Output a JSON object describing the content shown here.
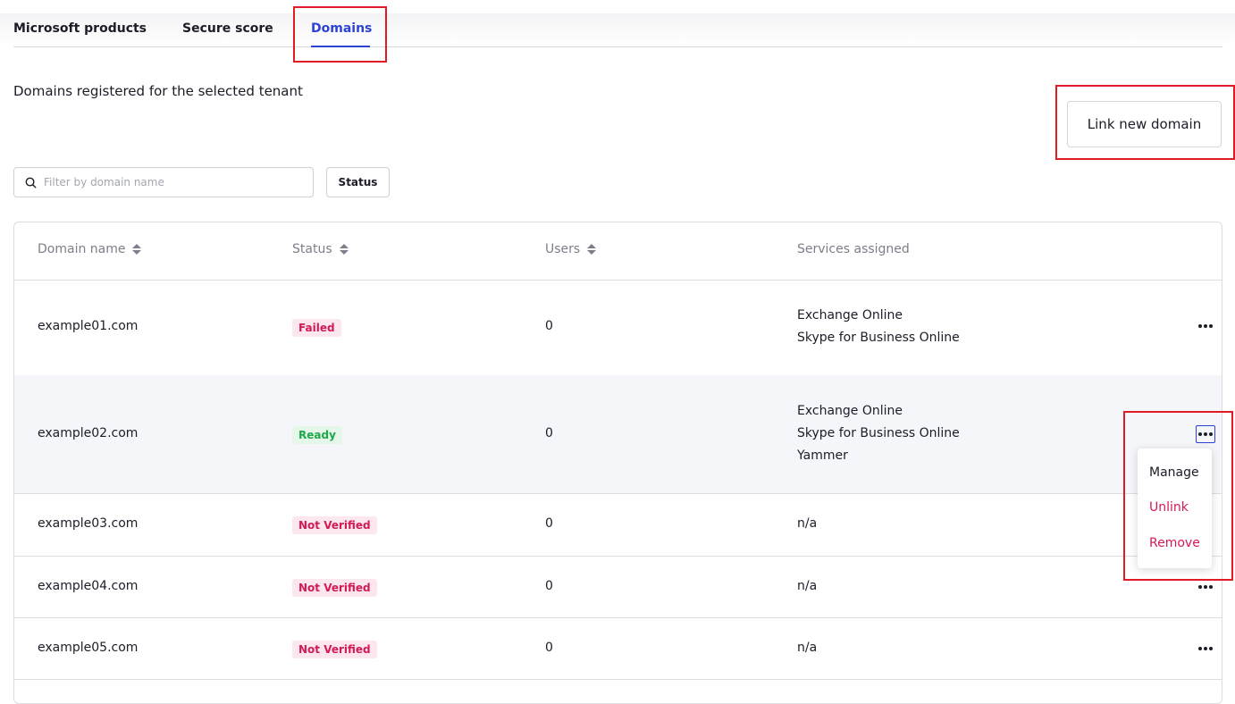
{
  "tabs": [
    {
      "label": "Microsoft products",
      "active": false
    },
    {
      "label": "Secure score",
      "active": false
    },
    {
      "label": "Domains",
      "active": true
    }
  ],
  "page": {
    "subtitle": "Domains registered for the selected tenant",
    "link_button": "Link new domain"
  },
  "filters": {
    "search_placeholder": "Filter by domain name",
    "status_button": "Status"
  },
  "table": {
    "columns": [
      "Domain name",
      "Status",
      "Users",
      "Services assigned"
    ],
    "rows": [
      {
        "domain": "example01.com",
        "status": "Failed",
        "users": "0",
        "services": [
          "Exchange Online",
          "Skype for Business Online"
        ]
      },
      {
        "domain": "example02.com",
        "status": "Ready",
        "users": "0",
        "services": [
          "Exchange Online",
          "Skype for Business Online",
          "Yammer"
        ]
      },
      {
        "domain": "example03.com",
        "status": "Not Verified",
        "users": "0",
        "services": [
          "n/a"
        ]
      },
      {
        "domain": "example04.com",
        "status": "Not Verified",
        "users": "0",
        "services": [
          "n/a"
        ]
      },
      {
        "domain": "example05.com",
        "status": "Not Verified",
        "users": "0",
        "services": [
          "n/a"
        ]
      }
    ]
  },
  "row_menu": {
    "items": [
      "Manage",
      "Unlink",
      "Remove"
    ]
  },
  "icons": {
    "search": "search-icon",
    "sort": "sort-icon",
    "more": "more-horizontal-icon"
  },
  "colors": {
    "accent": "#2f42d6",
    "danger": "#d41a55",
    "success": "#1ea84a",
    "highlight": "#e01b24"
  }
}
